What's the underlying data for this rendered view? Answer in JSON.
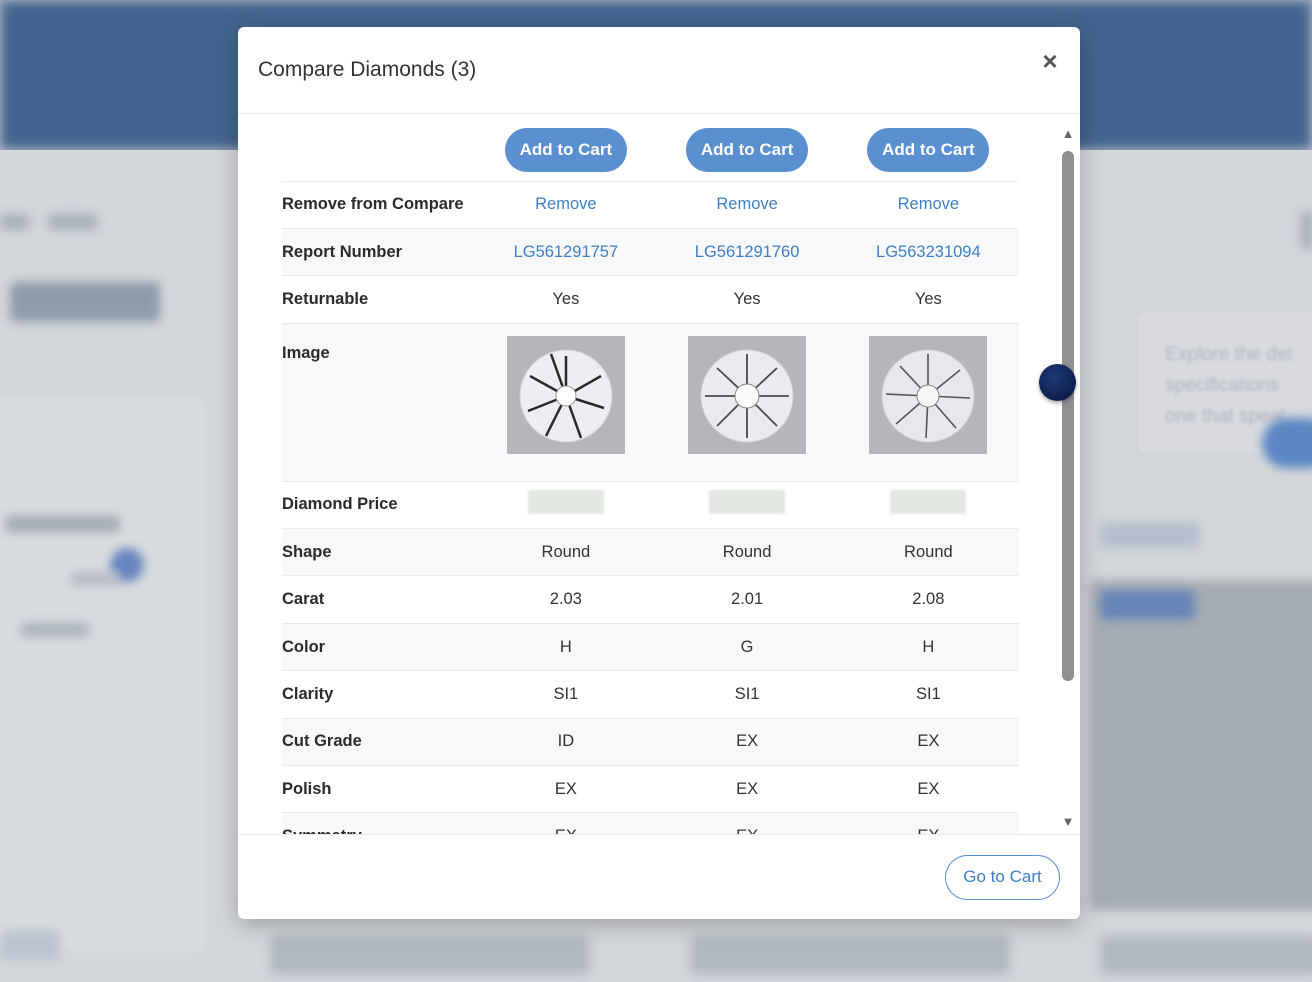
{
  "modal": {
    "title": "Compare Diamonds (3)",
    "close_label": "×",
    "go_to_cart_label": "Go to Cart"
  },
  "table": {
    "add_to_cart_label": "Add to Cart",
    "rows": {
      "remove": {
        "label": "Remove from Compare",
        "values": [
          "Remove",
          "Remove",
          "Remove"
        ]
      },
      "report": {
        "label": "Report Number",
        "values": [
          "LG561291757",
          "LG561291760",
          "LG563231094"
        ]
      },
      "returnable": {
        "label": "Returnable",
        "values": [
          "Yes",
          "Yes",
          "Yes"
        ]
      },
      "image": {
        "label": "Image"
      },
      "price": {
        "label": "Diamond Price"
      },
      "shape": {
        "label": "Shape",
        "values": [
          "Round",
          "Round",
          "Round"
        ]
      },
      "carat": {
        "label": "Carat",
        "values": [
          "2.03",
          "2.01",
          "2.08"
        ]
      },
      "color": {
        "label": "Color",
        "values": [
          "H",
          "G",
          "H"
        ]
      },
      "clarity": {
        "label": "Clarity",
        "values": [
          "SI1",
          "SI1",
          "SI1"
        ]
      },
      "cut": {
        "label": "Cut Grade",
        "values": [
          "ID",
          "EX",
          "EX"
        ]
      },
      "polish": {
        "label": "Polish",
        "values": [
          "EX",
          "EX",
          "EX"
        ]
      },
      "symmetry": {
        "label": "Symmetry",
        "values": [
          "EX",
          "EX",
          "EX"
        ]
      }
    }
  },
  "scrollbar": {
    "up_icon": "▲",
    "down_icon": "▼"
  },
  "background": {
    "tooltip_lines": [
      "Explore the det",
      "specifications",
      "one that speal"
    ]
  },
  "colors": {
    "accent": "#5a8fd0",
    "link": "#3f7fc8",
    "header_bg": "#3f6596"
  }
}
